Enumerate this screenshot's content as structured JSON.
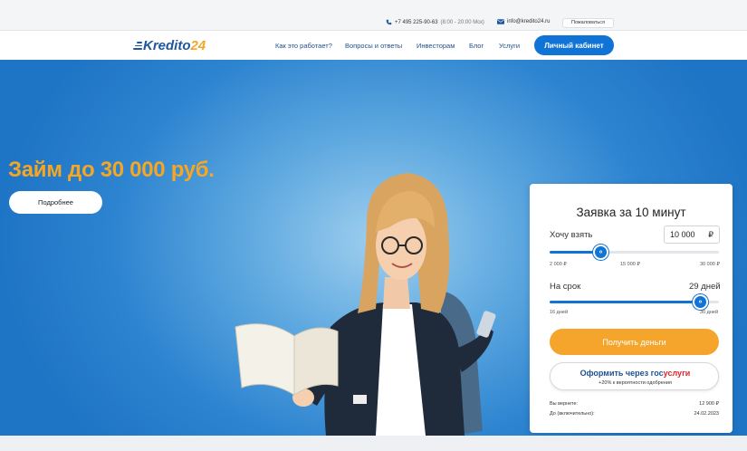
{
  "topbar": {
    "phone": "+7 495 225-90-63",
    "hours": "(8:00 - 20:00 Мск)",
    "email": "info@kredito24.ru",
    "complain_label": "Пожаловаться"
  },
  "header": {
    "logo_main": "Kredito",
    "logo_num": "24",
    "nav": [
      {
        "label": "Как это работает?"
      },
      {
        "label": "Вопросы и ответы"
      },
      {
        "label": "Инвесторам"
      },
      {
        "label": "Блог"
      },
      {
        "label": "Услуги"
      }
    ],
    "cabinet_label": "Личный кабинет"
  },
  "hero": {
    "title": "Займ до 30 000 руб.",
    "more_label": "Подробнее"
  },
  "form": {
    "title": "Заявка за 10 минут",
    "amount_label": "Хочу взять",
    "amount_value": "10 000",
    "currency": "₽",
    "amount_min": "2 000 ₽",
    "amount_mid": "15 000 ₽",
    "amount_max": "30 000 ₽",
    "amount_level": 0.3,
    "term_label": "На срок",
    "term_value": "29 дней",
    "term_min": "16 дней",
    "term_max": "30 дней",
    "term_level": 0.89,
    "knob_glyph": "‹›",
    "get_label": "Получить деньги",
    "gos_prefix": "Оформить через",
    "gos_brand_a": "гос",
    "gos_brand_b": "услуги",
    "gos_note": "+20% к вероятности одобрения",
    "return_label": "Вы вернете:",
    "return_value": "12 900 ₽",
    "until_label": "До (включительно):",
    "until_value": "24.02.2023"
  },
  "colors": {
    "accent": "#1073d6",
    "orange": "#f5a623",
    "hero_bg": "#1f75c5"
  }
}
